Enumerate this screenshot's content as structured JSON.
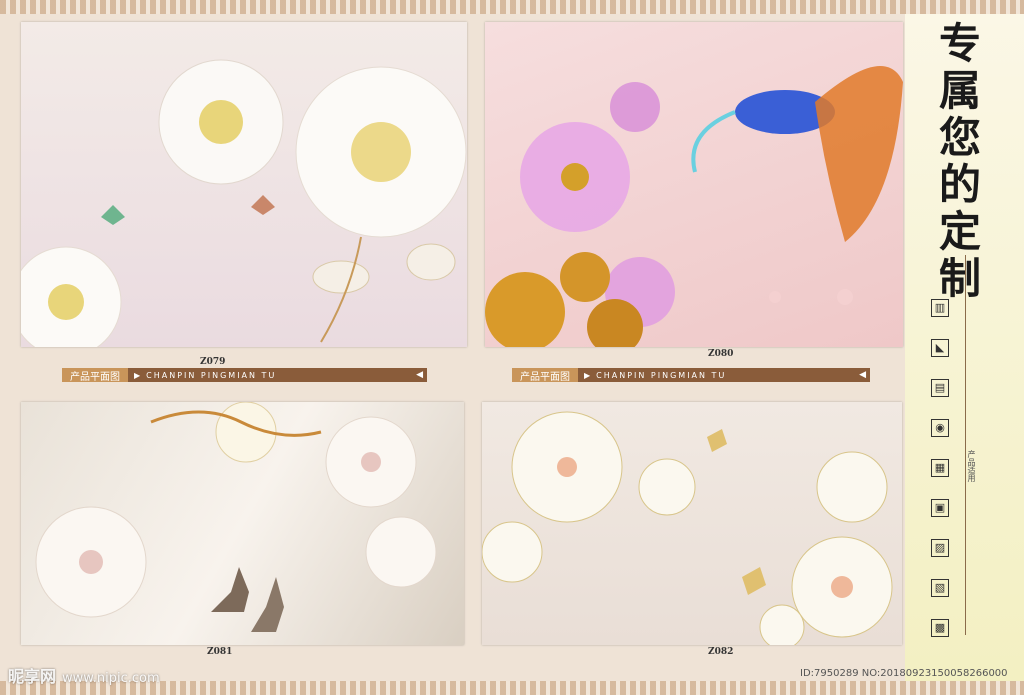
{
  "title": "专属您的定制",
  "panels": [
    {
      "code": "Z079",
      "banner_cn": "产品平面图",
      "banner_en": "CHANPIN PINGMIAN TU"
    },
    {
      "code": "Z080",
      "banner_cn": "产品平面图",
      "banner_en": "CHANPIN PINGMIAN TU"
    },
    {
      "code": "Z081"
    },
    {
      "code": "Z082"
    }
  ],
  "sidebar": {
    "vertical_label": "产品适用",
    "icons": [
      "hotel-icon",
      "ktv-icon",
      "tv-wall-icon",
      "restaurant-icon",
      "sofa-icon",
      "office-icon",
      "bedroom-icon",
      "dining-icon",
      "study-icon"
    ]
  },
  "watermark": {
    "brand": "昵享网",
    "url": "www.nipic.com"
  },
  "id_text": "ID:7950289 NO:20180923150058266000"
}
